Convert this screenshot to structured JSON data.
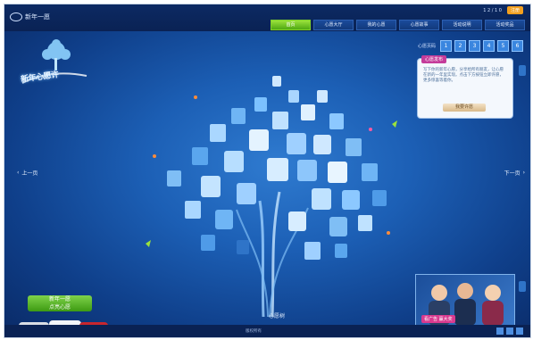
{
  "header": {
    "brand_text": "新年一愿",
    "util_label": "1 2 / 1 0",
    "util_button": "注册",
    "nav": [
      {
        "label": "首页"
      },
      {
        "label": "心愿大厅"
      },
      {
        "label": "我的心愿"
      },
      {
        "label": "心愿故事"
      },
      {
        "label": "活动说明"
      },
      {
        "label": "活动奖品"
      }
    ]
  },
  "campaign": {
    "title": "新年心愿许"
  },
  "pager": {
    "label": "心愿页码",
    "pages": [
      "1",
      "2",
      "3",
      "4",
      "5",
      "6"
    ]
  },
  "panel": {
    "tag": "心愿发布",
    "body": "写下你的新年心愿，分享给所有朋友，让心愿在新的一年里实现。点击下方按钮立即许愿，更多惊喜等着你。",
    "action": "我要许愿"
  },
  "side_nav": {
    "prev": "上一页",
    "next": "下一页"
  },
  "center_label": "心愿树",
  "promo": {
    "caption": "看广告 赢大奖"
  },
  "cars": {
    "badge_line1": "新年一愿",
    "badge_line2": "点亮心愿"
  },
  "footer": {
    "text": "版权所有"
  },
  "colors": {
    "bg_center": "#2f7bd0",
    "bg_edge": "#0a2a66",
    "accent_green": "#7fd34a",
    "accent_pink": "#c43c9a",
    "accent_orange": "#f4a01e"
  }
}
